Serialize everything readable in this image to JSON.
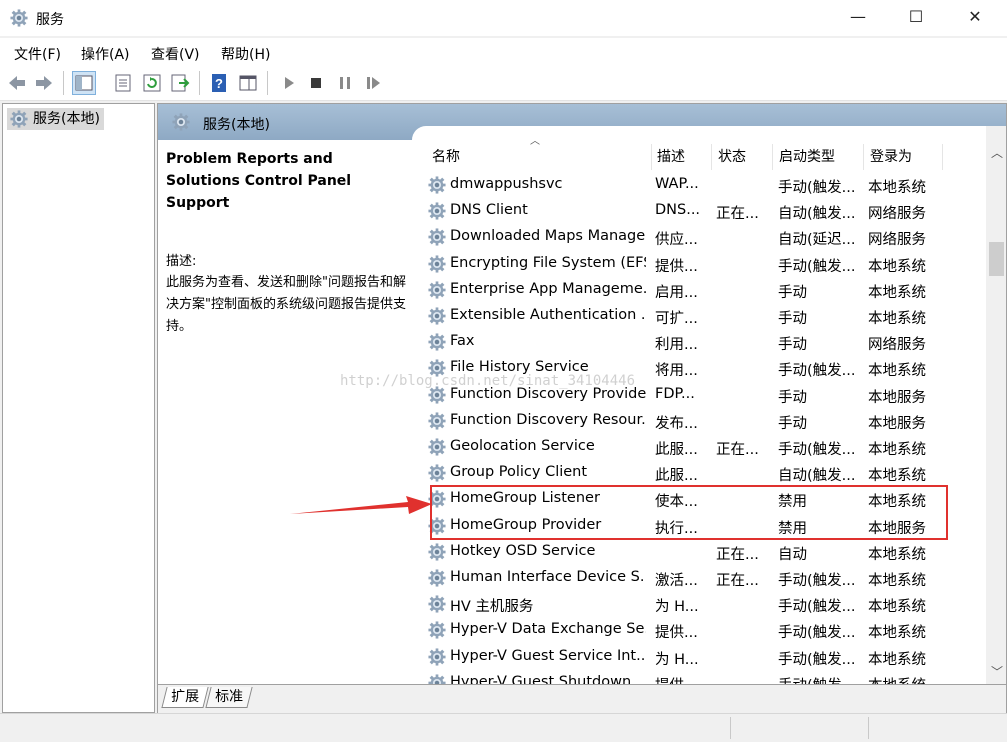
{
  "window": {
    "title": "服务",
    "minimize": "—",
    "maximize": "☐",
    "close": "✕"
  },
  "menu": [
    "文件(F)",
    "操作(A)",
    "查看(V)",
    "帮助(H)"
  ],
  "toolbar": [
    "back-icon",
    "forward-icon",
    "show-hide-console-tree-icon",
    "properties-icon",
    "refresh-icon",
    "export-list-icon",
    "help-icon",
    "show-hide-action-pane-icon",
    "start-service-icon",
    "stop-service-icon",
    "pause-service-icon",
    "restart-service-icon"
  ],
  "tree": {
    "root_label": "服务(本地)"
  },
  "main": {
    "header_label": "服务(本地)"
  },
  "description": {
    "service_title": "Problem Reports and Solutions Control Panel Support",
    "label": "描述:",
    "text": "此服务为查看、发送和删除\"问题报告和解决方案\"控制面板的系统级问题报告提供支持。"
  },
  "columns": {
    "name": "名称",
    "desc": "描述",
    "status": "状态",
    "startup": "启动类型",
    "logon": "登录为"
  },
  "rows": [
    {
      "name": "dmwappushsvc",
      "desc": "WAP...",
      "status": "",
      "startup": "手动(触发...",
      "logon": "本地系统"
    },
    {
      "name": "DNS Client",
      "desc": "DNS...",
      "status": "正在...",
      "startup": "自动(触发...",
      "logon": "网络服务"
    },
    {
      "name": "Downloaded Maps Manager",
      "desc": "供应...",
      "status": "",
      "startup": "自动(延迟...",
      "logon": "网络服务"
    },
    {
      "name": "Encrypting File System (EFS)",
      "desc": "提供...",
      "status": "",
      "startup": "手动(触发...",
      "logon": "本地系统"
    },
    {
      "name": "Enterprise App Manageme...",
      "desc": "启用...",
      "status": "",
      "startup": "手动",
      "logon": "本地系统"
    },
    {
      "name": "Extensible Authentication ...",
      "desc": "可扩...",
      "status": "",
      "startup": "手动",
      "logon": "本地系统"
    },
    {
      "name": "Fax",
      "desc": "利用...",
      "status": "",
      "startup": "手动",
      "logon": "网络服务"
    },
    {
      "name": "File History Service",
      "desc": "将用...",
      "status": "",
      "startup": "手动(触发...",
      "logon": "本地系统"
    },
    {
      "name": "Function Discovery Provide...",
      "desc": "FDP...",
      "status": "",
      "startup": "手动",
      "logon": "本地服务"
    },
    {
      "name": "Function Discovery Resour...",
      "desc": "发布...",
      "status": "",
      "startup": "手动",
      "logon": "本地服务"
    },
    {
      "name": "Geolocation Service",
      "desc": "此服...",
      "status": "正在...",
      "startup": "手动(触发...",
      "logon": "本地系统"
    },
    {
      "name": "Group Policy Client",
      "desc": "此服...",
      "status": "",
      "startup": "自动(触发...",
      "logon": "本地系统"
    },
    {
      "name": "HomeGroup Listener",
      "desc": "使本...",
      "status": "",
      "startup": "禁用",
      "logon": "本地系统"
    },
    {
      "name": "HomeGroup Provider",
      "desc": "执行...",
      "status": "",
      "startup": "禁用",
      "logon": "本地服务"
    },
    {
      "name": "Hotkey OSD Service",
      "desc": "",
      "status": "正在...",
      "startup": "自动",
      "logon": "本地系统"
    },
    {
      "name": "Human Interface Device S...",
      "desc": "激活...",
      "status": "正在...",
      "startup": "手动(触发...",
      "logon": "本地系统"
    },
    {
      "name": "HV 主机服务",
      "desc": "为 H...",
      "status": "",
      "startup": "手动(触发...",
      "logon": "本地系统"
    },
    {
      "name": "Hyper-V Data Exchange Se...",
      "desc": "提供...",
      "status": "",
      "startup": "手动(触发...",
      "logon": "本地系统"
    },
    {
      "name": "Hyper-V Guest Service Int...",
      "desc": "为 H...",
      "status": "",
      "startup": "手动(触发...",
      "logon": "本地系统"
    },
    {
      "name": "Hyper-V Guest Shutdown ...",
      "desc": "提供...",
      "status": "",
      "startup": "手动(触发...",
      "logon": "本地系统"
    }
  ],
  "tabs": [
    "扩展",
    "标准"
  ],
  "watermark": "http://blog.csdn.net/sinat_34104446",
  "colors": {
    "highlight": "#e0312e",
    "header": "#a7bfd6"
  }
}
